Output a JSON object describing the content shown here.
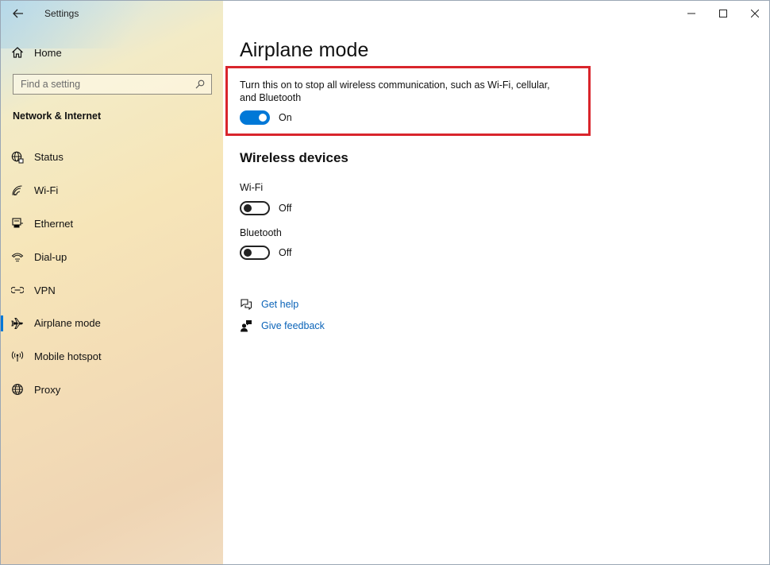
{
  "window": {
    "title": "Settings"
  },
  "sidebar": {
    "home_label": "Home",
    "search": {
      "placeholder": "Find a setting"
    },
    "section_title": "Network & Internet",
    "items": [
      {
        "label": "Status",
        "icon": "globe-status-icon"
      },
      {
        "label": "Wi-Fi",
        "icon": "wifi-icon"
      },
      {
        "label": "Ethernet",
        "icon": "ethernet-icon"
      },
      {
        "label": "Dial-up",
        "icon": "dialup-icon"
      },
      {
        "label": "VPN",
        "icon": "vpn-icon"
      },
      {
        "label": "Airplane mode",
        "icon": "airplane-icon",
        "active": true
      },
      {
        "label": "Mobile hotspot",
        "icon": "hotspot-icon"
      },
      {
        "label": "Proxy",
        "icon": "globe-icon"
      }
    ]
  },
  "main": {
    "title": "Airplane mode",
    "description": "Turn this on to stop all wireless communication, such as Wi-Fi, cellular, and Bluetooth",
    "airplane_toggle": {
      "state": "On"
    },
    "wireless_heading": "Wireless devices",
    "wifi": {
      "label": "Wi-Fi",
      "state": "Off"
    },
    "bluetooth": {
      "label": "Bluetooth",
      "state": "Off"
    },
    "links": {
      "help": "Get help",
      "feedback": "Give feedback"
    }
  },
  "colors": {
    "accent": "#0078d7",
    "highlight_border": "#d9252c",
    "link": "#0a63b8"
  }
}
